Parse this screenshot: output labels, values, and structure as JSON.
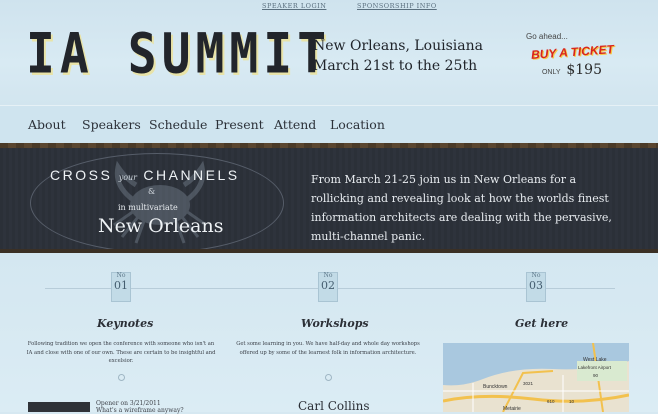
{
  "header": {
    "links": [
      "SPEAKER LOGIN",
      "SPONSORSHIP INFO"
    ],
    "logo": "IA SUMMIT",
    "location": "New Orleans, Louisiana",
    "dates": "March 21st to the 25th",
    "ticket": {
      "go_ahead": "Go ahead...",
      "buy": "BUY A TICKET",
      "only": "ONLY",
      "price": "$195"
    }
  },
  "nav": [
    "About",
    "Speakers",
    "Schedule",
    "Present",
    "Attend",
    "Location"
  ],
  "hero": {
    "cross": "CROSS",
    "your": "your",
    "channels": "CHANNELS",
    "amp": "&",
    "multivariate": "in multivariate",
    "city": "New Orleans",
    "blurb": "From March 21-25 join us in New Orleans for a rollicking and revealing look at how the worlds finest information architects are dealing with the pervasive, multi-channel panic."
  },
  "columns": [
    {
      "no": "No",
      "num": "01",
      "title": "Keynotes",
      "text": "Following tradition we open the conference with someone who isn't an IA and close with one of our own. These are certain to be insightful and excelsior."
    },
    {
      "no": "No",
      "num": "02",
      "title": "Workshops",
      "text": "Get some learning in you. We have half-day and whole day workshops offered up by some of the learnest folk in information architecture."
    },
    {
      "no": "No",
      "num": "03",
      "title": "Get here",
      "text": ""
    }
  ],
  "map": {
    "labels": [
      "West Lake",
      "Lakefront Airport",
      "Buncktown",
      "Metairie"
    ],
    "routes": [
      "3021",
      "90",
      "610",
      "10"
    ]
  },
  "speaker": {
    "meta1": "Opener on 3/21/2011",
    "meta2": "What's a wireframe anyway?",
    "name": "Carl Collins"
  },
  "colors": {
    "background": "#d6e8f1",
    "hero": "#2b3038",
    "accent": "#d8261c"
  }
}
